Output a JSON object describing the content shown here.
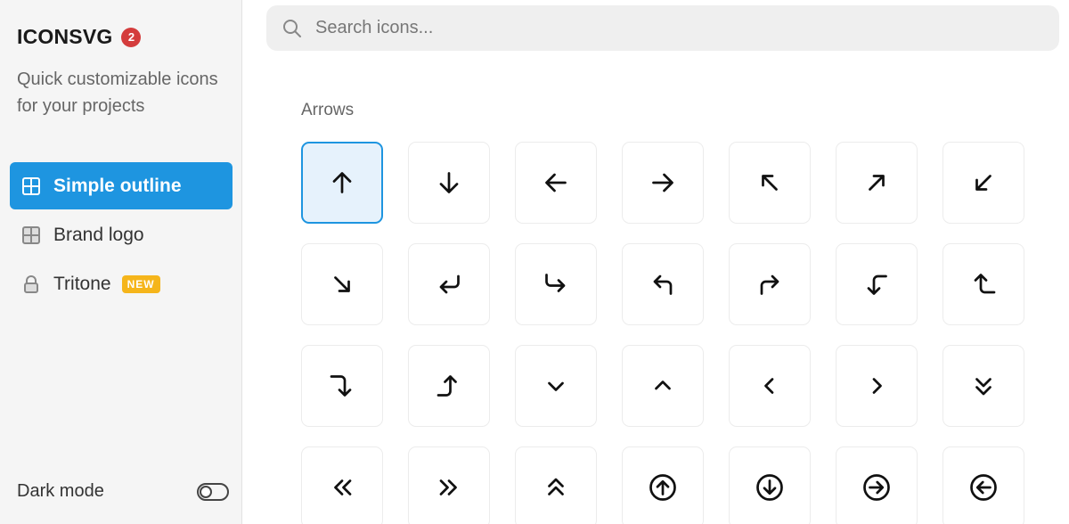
{
  "brand": {
    "name": "ICONSVG",
    "badge": "2"
  },
  "tagline": "Quick customizable icons for your projects",
  "nav": [
    {
      "label": "Simple outline",
      "icon": "grid-icon",
      "active": true
    },
    {
      "label": "Brand logo",
      "icon": "grid-icon",
      "active": false
    },
    {
      "label": "Tritone",
      "icon": "lock-icon",
      "active": false,
      "badge": "NEW"
    }
  ],
  "dark_mode": {
    "label": "Dark mode",
    "enabled": false
  },
  "search": {
    "placeholder": "Search icons..."
  },
  "section": {
    "title": "Arrows"
  },
  "icons": [
    "arrow-up",
    "arrow-down",
    "arrow-left",
    "arrow-right",
    "arrow-up-left",
    "arrow-up-right",
    "arrow-down-left",
    "arrow-down-right",
    "corner-down-left",
    "corner-down-right",
    "corner-up-left",
    "corner-up-right",
    "corner-left-down",
    "corner-left-up",
    "corner-right-down",
    "corner-right-up",
    "chevron-down",
    "chevron-up",
    "chevron-left",
    "chevron-right",
    "chevrons-down",
    "chevrons-left",
    "chevrons-right",
    "chevrons-up",
    "circle-arrow-up",
    "circle-arrow-down",
    "circle-arrow-right",
    "circle-arrow-left"
  ],
  "selected_icon": "arrow-up",
  "colors": {
    "accent": "#1e95e0",
    "badge_red": "#d43c3c",
    "badge_yellow": "#f5b51b"
  }
}
